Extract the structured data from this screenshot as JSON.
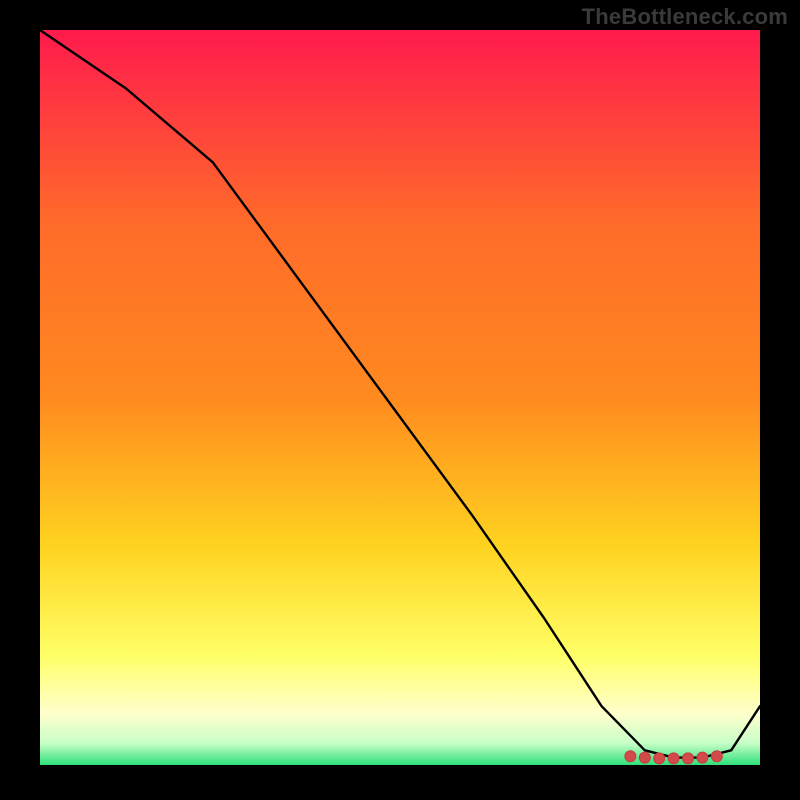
{
  "watermark": "TheBottleneck.com",
  "chart_data": {
    "type": "line",
    "title": "",
    "xlabel": "",
    "ylabel": "",
    "xlim": [
      0,
      100
    ],
    "ylim": [
      0,
      100
    ],
    "grid": false,
    "series": [
      {
        "name": "curve",
        "x": [
          0,
          12,
          24,
          36,
          48,
          60,
          70,
          78,
          84,
          88,
          92,
          96,
          100
        ],
        "y": [
          100,
          92,
          82,
          66,
          50,
          34,
          20,
          8,
          2,
          1,
          1,
          2,
          8
        ]
      }
    ],
    "markers": {
      "name": "flat-region",
      "x": [
        82,
        84,
        86,
        88,
        90,
        92,
        94
      ],
      "y": [
        1.2,
        1.0,
        0.9,
        0.9,
        0.9,
        1.0,
        1.2
      ]
    },
    "bottom_band_y": 5
  },
  "colors": {
    "background": "#000000",
    "gradient_top": "#ff1a4d",
    "gradient_mid_upper": "#ff8a1f",
    "gradient_mid": "#ffd21f",
    "gradient_mid_lower": "#ffff66",
    "gradient_pale": "#ffffcc",
    "gradient_bottom": "#2fe07a",
    "line": "#000000",
    "marker": "#d24a4a",
    "watermark": "#3a3a3a"
  }
}
